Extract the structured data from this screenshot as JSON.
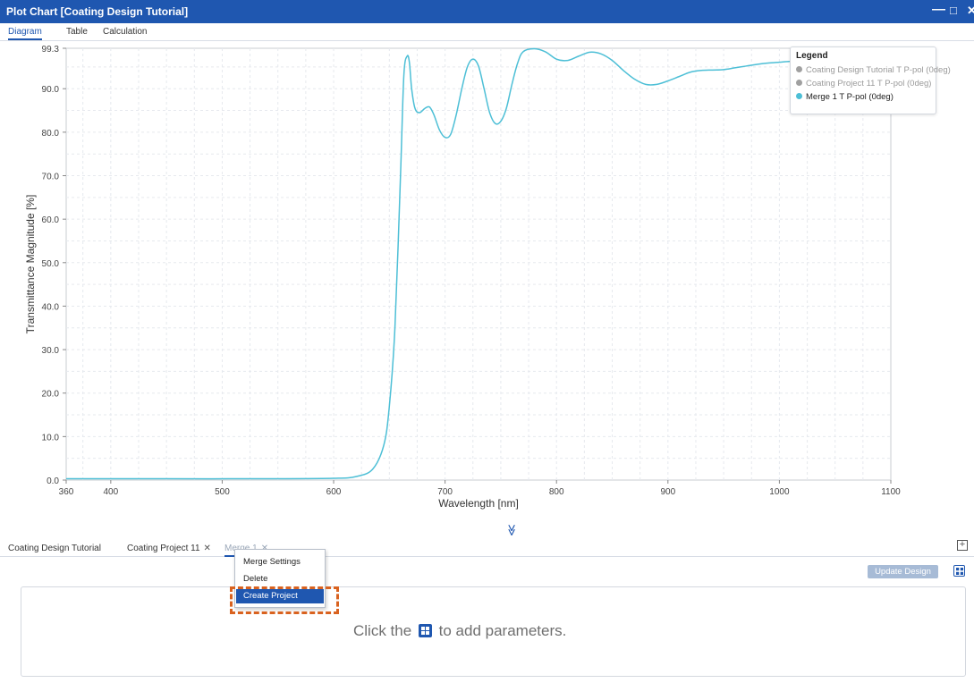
{
  "window": {
    "title": "Plot Chart [Coating Design Tutorial]",
    "controls": {
      "minimize": "—",
      "maximize": "□",
      "close": "✕"
    }
  },
  "view_tabs": [
    {
      "label": "Diagram",
      "active": true
    },
    {
      "label": "Table",
      "active": false
    },
    {
      "label": "Calculation",
      "active": false
    }
  ],
  "legend": {
    "title": "Legend",
    "items": [
      {
        "label": "Coating Design Tutorial T P-pol (0deg)",
        "color": "#a0a0a0",
        "active": false
      },
      {
        "label": "Coating Project 11 T P-pol (0deg)",
        "color": "#a0a0a0",
        "active": false
      },
      {
        "label": "Merge 1 T P-pol (0deg)",
        "color": "#4dbfd6",
        "active": true
      }
    ]
  },
  "chart_data": {
    "type": "line",
    "xlabel": "Wavelength [nm]",
    "ylabel": "Transmittance Magnitude [%]",
    "xlim": [
      360,
      1100
    ],
    "ylim": [
      0,
      99.3
    ],
    "x_ticks": [
      "360",
      "400",
      "500",
      "600",
      "700",
      "800",
      "900",
      "1000",
      "1100"
    ],
    "y_ticks": [
      "99.3",
      "90.0",
      "80.0",
      "70.0",
      "60.0",
      "50.0",
      "40.0",
      "30.0",
      "20.0",
      "10.0",
      "0.0"
    ],
    "grid": true,
    "legend_position": "top-right",
    "series": [
      {
        "name": "Merge 1 T P-pol (0deg)",
        "color": "#4dbfd6",
        "x": [
          360,
          450,
          550,
          600,
          620,
          635,
          645,
          650,
          655,
          660,
          663,
          666,
          668,
          670,
          673,
          677,
          682,
          686,
          690,
          695,
          700,
          705,
          710,
          715,
          720,
          725,
          730,
          735,
          740,
          745,
          750,
          755,
          760,
          765,
          770,
          780,
          790,
          800,
          810,
          820,
          830,
          840,
          850,
          860,
          870,
          880,
          890,
          900,
          910,
          920,
          930,
          940,
          950,
          960,
          970,
          980,
          990,
          1000,
          1010,
          1020,
          1030
        ],
        "y": [
          0.3,
          0.3,
          0.3,
          0.4,
          0.8,
          2.5,
          8,
          17,
          35,
          70,
          93,
          97.5,
          96,
          90,
          85.5,
          84.5,
          85.5,
          85.8,
          84,
          80.5,
          78.8,
          79.5,
          84,
          90,
          95,
          96.8,
          95.2,
          90,
          84.5,
          82,
          82.5,
          85.5,
          91,
          95.8,
          98.5,
          99.2,
          98.5,
          96.8,
          96.5,
          97.5,
          98.4,
          98,
          96.5,
          94.2,
          92.2,
          91,
          91,
          91.8,
          92.8,
          93.8,
          94.2,
          94.3,
          94.4,
          94.8,
          95.2,
          95.6,
          95.9,
          96.1,
          96.3,
          96.4,
          96.4
        ]
      }
    ]
  },
  "dock_tabs": [
    {
      "label": "Coating Design Tutorial",
      "closable": false,
      "active": false
    },
    {
      "label": "Coating Project 11",
      "closable": true,
      "active": false
    },
    {
      "label": "Merge 1",
      "closable": true,
      "active": true
    }
  ],
  "close_glyph": "✕",
  "add_tab_glyph": "+",
  "collapse_glyph": "≫",
  "update_design_label": "Update Design",
  "context_menu": {
    "items": [
      {
        "label": "Merge Settings",
        "selected": false
      },
      {
        "label": "Delete",
        "selected": false
      },
      {
        "label": "Create Project",
        "selected": true
      }
    ]
  },
  "hint": {
    "before": "Click the",
    "after": "to add parameters."
  },
  "accent_color": "#1f57b0",
  "highlight_color": "#d9621f"
}
